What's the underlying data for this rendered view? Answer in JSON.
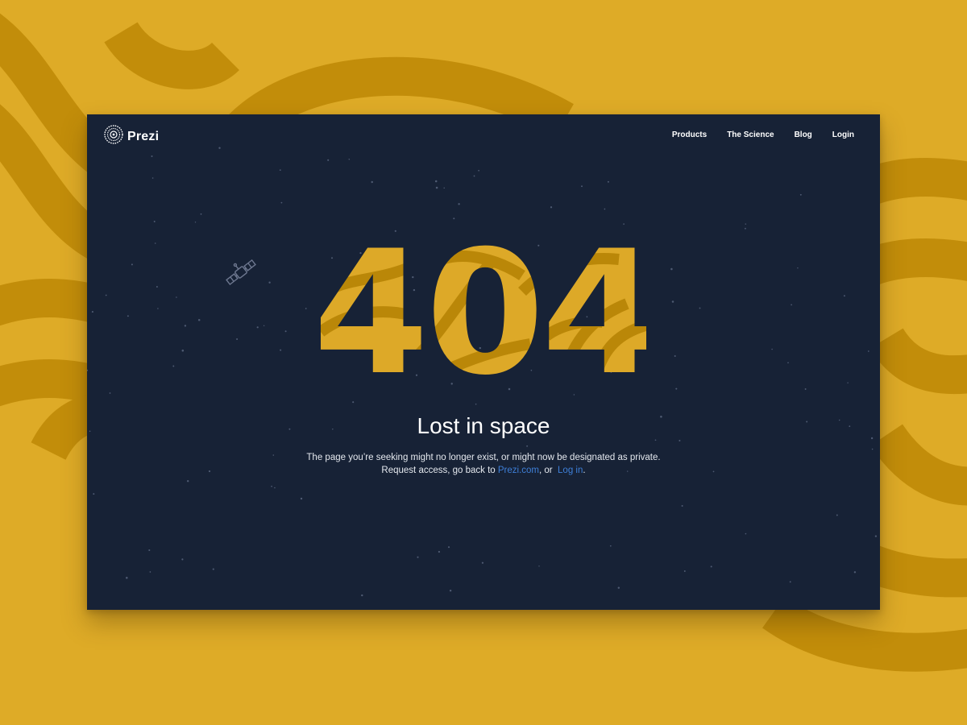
{
  "brand": {
    "name": "Prezi",
    "icon": "prezi-logo-icon"
  },
  "nav": {
    "items": [
      {
        "label": "Products"
      },
      {
        "label": "The Science"
      },
      {
        "label": "Blog"
      },
      {
        "label": "Login"
      }
    ]
  },
  "error": {
    "code": "404",
    "title": "Lost in space",
    "message_line1": "The page you’re seeking might no longer exist, or might now be designated as private.",
    "message_line2_prefix": "Request access, go back to ",
    "prezi_link": "Prezi.com",
    "message_sep": ", or ",
    "login_link": "Log in",
    "message_end": "."
  },
  "decor": {
    "satellite_icon": "satellite-icon"
  },
  "colors": {
    "background": "#DEAB27",
    "background_stripes": "#C28D0A",
    "window": "#172236",
    "digits_light": "#DDA928",
    "digits_dark": "#BA8708",
    "link": "#3E7FD8"
  }
}
